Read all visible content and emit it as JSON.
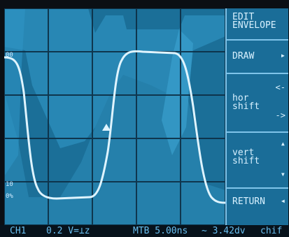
{
  "colors": {
    "screen_bg": "#1b6f98",
    "envelope": "#2e8fbd",
    "envelope_light": "#3aa1cf",
    "grid": "#0d2e44",
    "trace": "#dff4ff",
    "menu_text": "#d8f1ff",
    "status_text": "#69bff0"
  },
  "reference_labels": {
    "top": "00",
    "mid": "10",
    "low": "0%"
  },
  "menu": {
    "title_line1": "EDIT",
    "title_line2": "ENVELOPE",
    "draw": "DRAW",
    "draw_arrow": "▸",
    "hor_line1": "hor",
    "hor_line2": "shift",
    "hor_arrow_left": "<-",
    "hor_arrow_right": "->",
    "vert_line1": "vert",
    "vert_line2": "shift",
    "vert_arrow_up": "▴",
    "vert_arrow_down": "▾",
    "return": "RETURN",
    "return_arrow": "◂"
  },
  "status": {
    "channel": "CH1",
    "volts": "0.2 V=⊥z",
    "timebase": "MTB 5.00ns",
    "delay": "~ 3.42dv",
    "mode": "chif"
  },
  "icons": {
    "trigger_marker": "trigger-marker-icon"
  }
}
